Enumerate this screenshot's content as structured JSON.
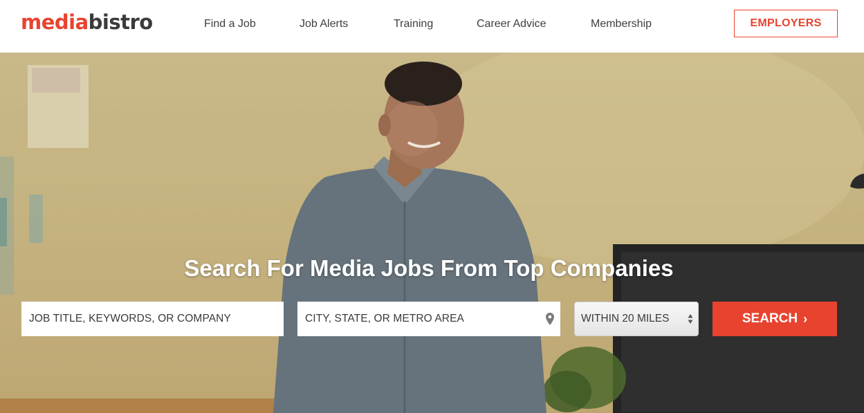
{
  "brand": {
    "logo_part1": "media",
    "logo_part2": "bistro"
  },
  "nav": {
    "items": [
      {
        "label": "Find a Job"
      },
      {
        "label": "Job Alerts"
      },
      {
        "label": "Training"
      },
      {
        "label": "Career Advice"
      },
      {
        "label": "Membership"
      }
    ],
    "employers_label": "EMPLOYERS"
  },
  "hero": {
    "headline": "Search For Media Jobs From Top Companies",
    "keyword_placeholder": "JOB TITLE, KEYWORDS, OR COMPANY",
    "location_placeholder": "CITY, STATE, OR METRO AREA",
    "radius_selected": "WITHIN 20 MILES",
    "search_label": "SEARCH",
    "search_chevron": "›",
    "icons": {
      "location": "map-pin-icon",
      "select": "updown-arrows-icon",
      "search_arrow": "chevron-right-icon"
    }
  },
  "colors": {
    "accent": "#e8432f",
    "text": "#3d3d3d",
    "hero_base": "#c4b27e"
  }
}
